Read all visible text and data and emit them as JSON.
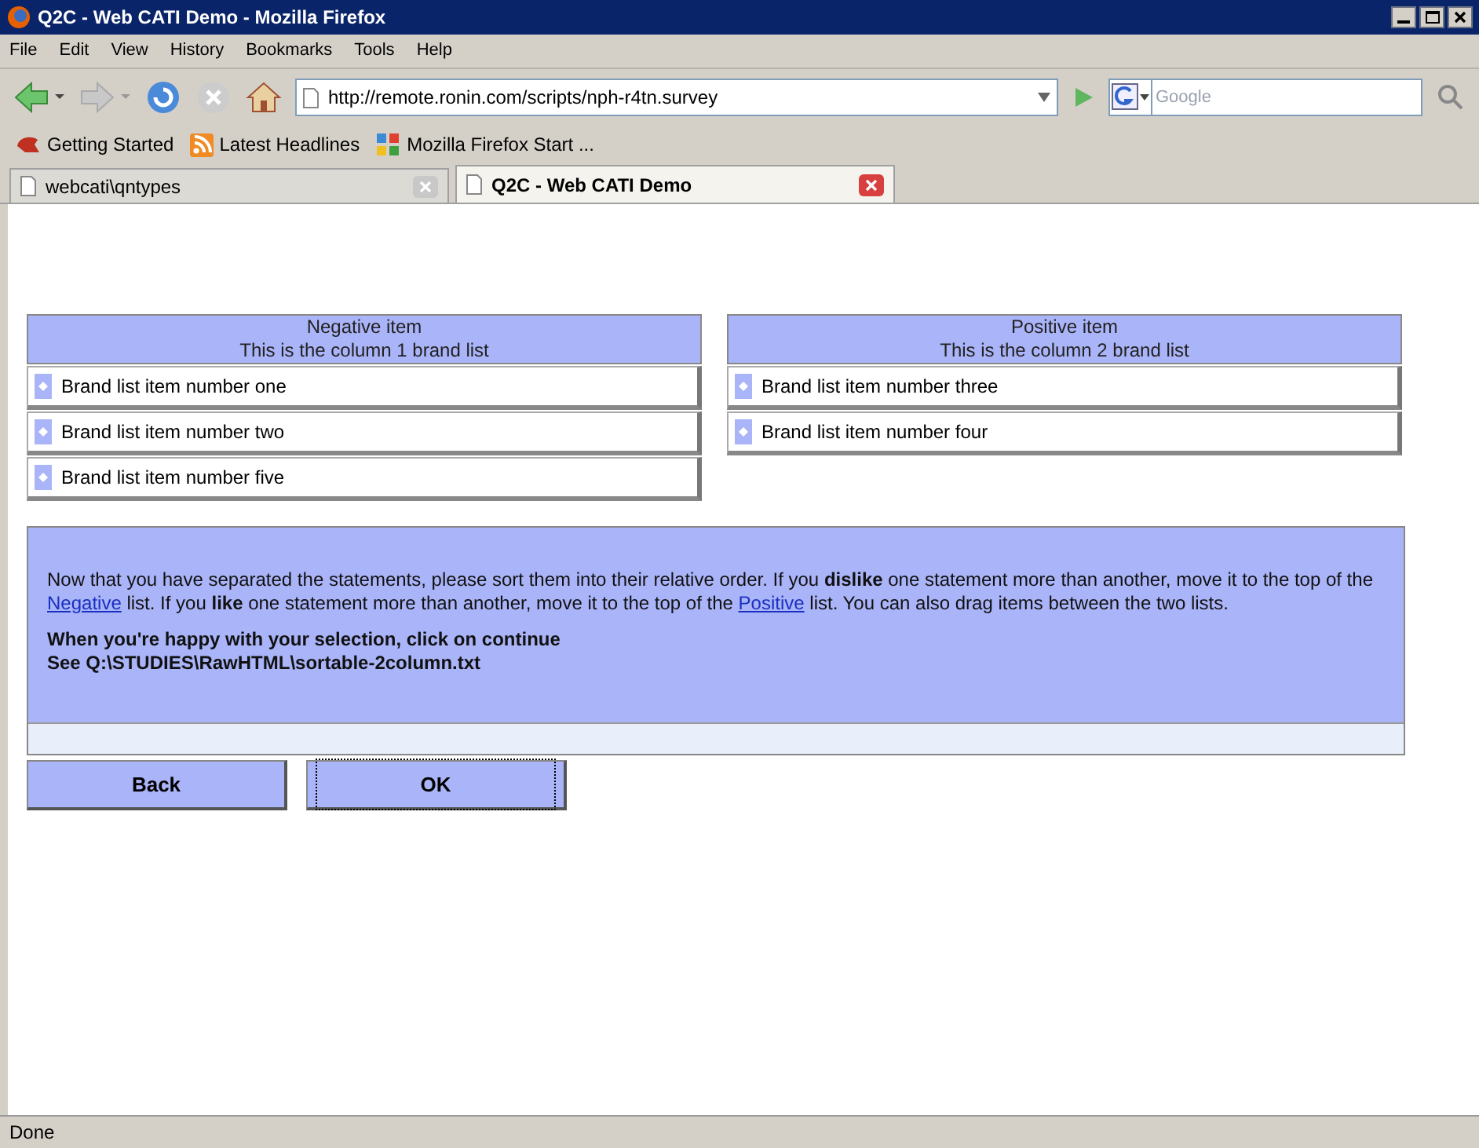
{
  "window": {
    "title": "Q2C - Web CATI Demo - Mozilla Firefox"
  },
  "menu": [
    "File",
    "Edit",
    "View",
    "History",
    "Bookmarks",
    "Tools",
    "Help"
  ],
  "address": {
    "value": "http://remote.ronin.com/scripts/nph-r4tn.survey"
  },
  "search": {
    "placeholder": "Google"
  },
  "bookmarks": [
    "Getting Started",
    "Latest Headlines",
    "Mozilla Firefox Start ..."
  ],
  "tabs": [
    {
      "label": "webcati\\qntypes",
      "selected": false
    },
    {
      "label": "Q2C - Web CATI Demo",
      "selected": true
    }
  ],
  "lists": [
    {
      "title": "Negative item",
      "subtitle": "This is the column 1 brand list",
      "items": [
        "Brand list item number one",
        "Brand list item number two",
        "Brand list item number five"
      ]
    },
    {
      "title": "Positive item",
      "subtitle": "This is the column 2 brand list",
      "items": [
        "Brand list item number three",
        "Brand list item number four"
      ]
    }
  ],
  "instructions": {
    "text": "Now that you have separated the statements, please sort them into their relative order. If you **dislike** one statement more than another, move it to the top of the ",
    "link1": "Negative",
    "mid": " list. If you **like** one statement more than another, move it to the top of the ",
    "link2": "Positive",
    "end": " list. You can also drag items between the two lists.",
    "bold_lines": [
      "When you're happy with your selection, click on continue",
      "See Q:\\STUDIES\\RawHTML\\sortable-2column.txt"
    ]
  },
  "buttons": [
    {
      "label": "Back",
      "focused": false
    },
    {
      "label": "OK",
      "focused": true
    }
  ],
  "status_bar": "Done"
}
